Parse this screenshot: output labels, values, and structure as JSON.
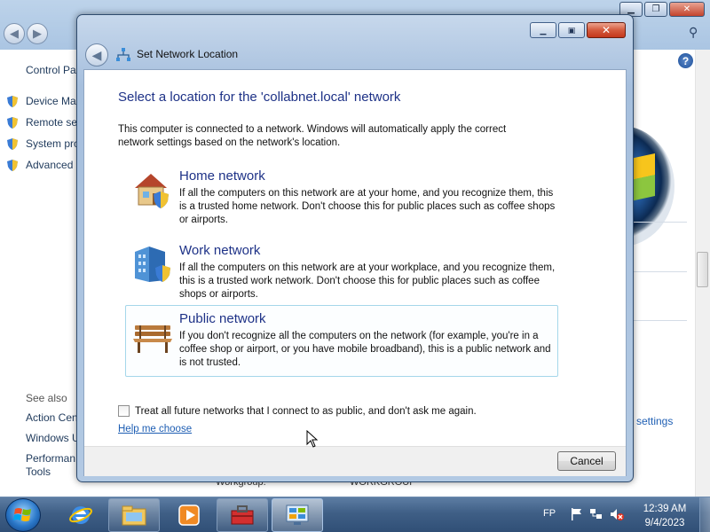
{
  "background_window": {
    "sidebar": {
      "control_panel_label": "Control Pa",
      "items": [
        "Device Mar",
        "Remote se",
        "System pro",
        "Advanced"
      ],
      "see_also_label": "See also",
      "see_also_items": [
        "Action Cen",
        "Windows U",
        "Performan",
        "Tools"
      ]
    },
    "settings_link": "settings",
    "workgroup_label": "Workgroup:",
    "workgroup_value": "WORKGROUP",
    "help_icon": "?"
  },
  "dialog": {
    "title": "Set Network Location",
    "heading": "Select a location for the 'collabnet.local' network",
    "intro": "This computer is connected to a network. Windows will automatically apply the correct network settings based on the network's location.",
    "options": [
      {
        "title": "Home network",
        "description": "If all the computers on this network are at your home, and you recognize them, this is a trusted home network.  Don't choose this for public places such as coffee shops or airports.",
        "icon": "home-network-icon"
      },
      {
        "title": "Work network",
        "description": "If all the computers on this network are at your workplace, and you recognize them, this is a trusted work network.  Don't choose this for public places such as coffee shops or airports.",
        "icon": "work-network-icon"
      },
      {
        "title": "Public network",
        "description": "If you don't recognize all the computers on the network (for example, you're in a coffee shop or airport, or you have mobile broadband), this is a public network and is not trusted.",
        "icon": "public-network-bench-icon",
        "highlighted": true
      }
    ],
    "checkbox_label": "Treat all future networks that I connect to as public, and don't ask me again.",
    "checkbox_checked": false,
    "help_link": "Help me choose",
    "cancel_button": "Cancel"
  },
  "taskbar": {
    "language": "FP",
    "clock_time": "12:39 AM",
    "clock_date": "9/4/2023",
    "pinned": [
      "internet-explorer-icon",
      "windows-explorer-icon",
      "media-player-icon",
      "toolbox-app-icon",
      "control-panel-icon"
    ]
  },
  "colors": {
    "heading_blue": "#1e3287",
    "link_blue": "#1e5eb3",
    "highlight_border": "#a5d7ea",
    "taskbar": "#3f5f86"
  }
}
